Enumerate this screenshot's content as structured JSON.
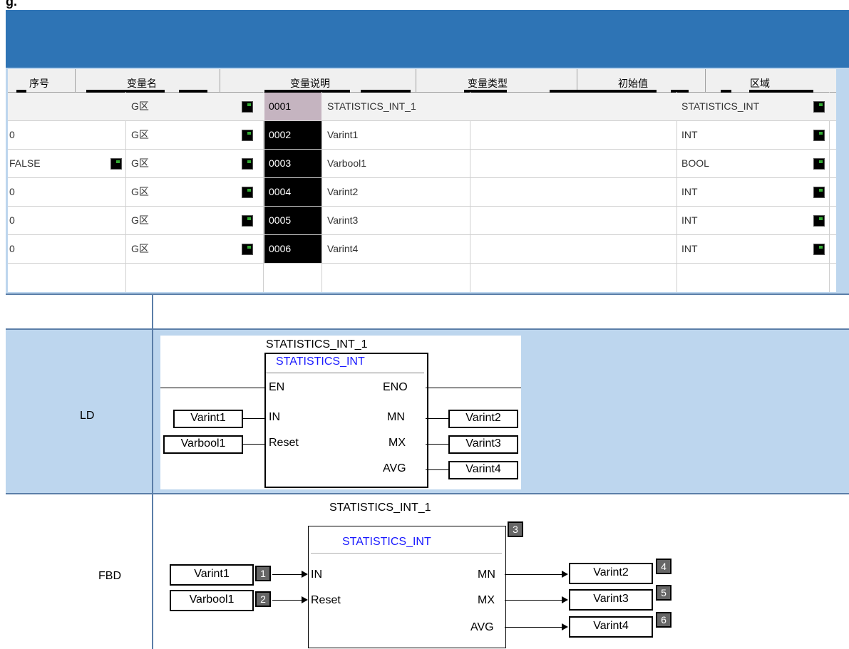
{
  "top_mark": "g.",
  "variable_table": {
    "headers": [
      "序号",
      "变量名",
      "变量说明",
      "变量类型",
      "初始值",
      "区域"
    ],
    "rows": [
      {
        "init": "",
        "area": "G区",
        "id": "0001",
        "name": "STATISTICS_INT_1",
        "desc": "",
        "type": "STATISTICS_INT",
        "selected": true
      },
      {
        "init": "0",
        "area": "G区",
        "id": "0002",
        "name": "Varint1",
        "desc": "",
        "type": "INT",
        "selected": false
      },
      {
        "init": "FALSE",
        "area": "G区",
        "id": "0003",
        "name": "Varbool1",
        "desc": "",
        "type": "BOOL",
        "selected": false
      },
      {
        "init": "0",
        "area": "G区",
        "id": "0004",
        "name": "Varint2",
        "desc": "",
        "type": "INT",
        "selected": false
      },
      {
        "init": "0",
        "area": "G区",
        "id": "0005",
        "name": "Varint3",
        "desc": "",
        "type": "INT",
        "selected": false
      },
      {
        "init": "0",
        "area": "G区",
        "id": "0006",
        "name": "Varint4",
        "desc": "",
        "type": "INT",
        "selected": false
      }
    ]
  },
  "ld": {
    "label": "LD",
    "instance": "STATISTICS_INT_1",
    "block_type": "STATISTICS_INT",
    "en": "EN",
    "eno": "ENO",
    "in": "IN",
    "reset": "Reset",
    "mn": "MN",
    "mx": "MX",
    "avg": "AVG",
    "var_in": "Varint1",
    "var_reset": "Varbool1",
    "var_mn": "Varint2",
    "var_mx": "Varint3",
    "var_avg": "Varint4"
  },
  "fbd": {
    "label": "FBD",
    "instance": "STATISTICS_INT_1",
    "block_type": "STATISTICS_INT",
    "in": "IN",
    "reset": "Reset",
    "mn": "MN",
    "mx": "MX",
    "avg": "AVG",
    "var_in": "Varint1",
    "var_reset": "Varbool1",
    "var_mn": "Varint2",
    "var_mx": "Varint3",
    "var_avg": "Varint4",
    "n1": "1",
    "n2": "2",
    "n3": "3",
    "n4": "4",
    "n5": "5",
    "n6": "6"
  }
}
